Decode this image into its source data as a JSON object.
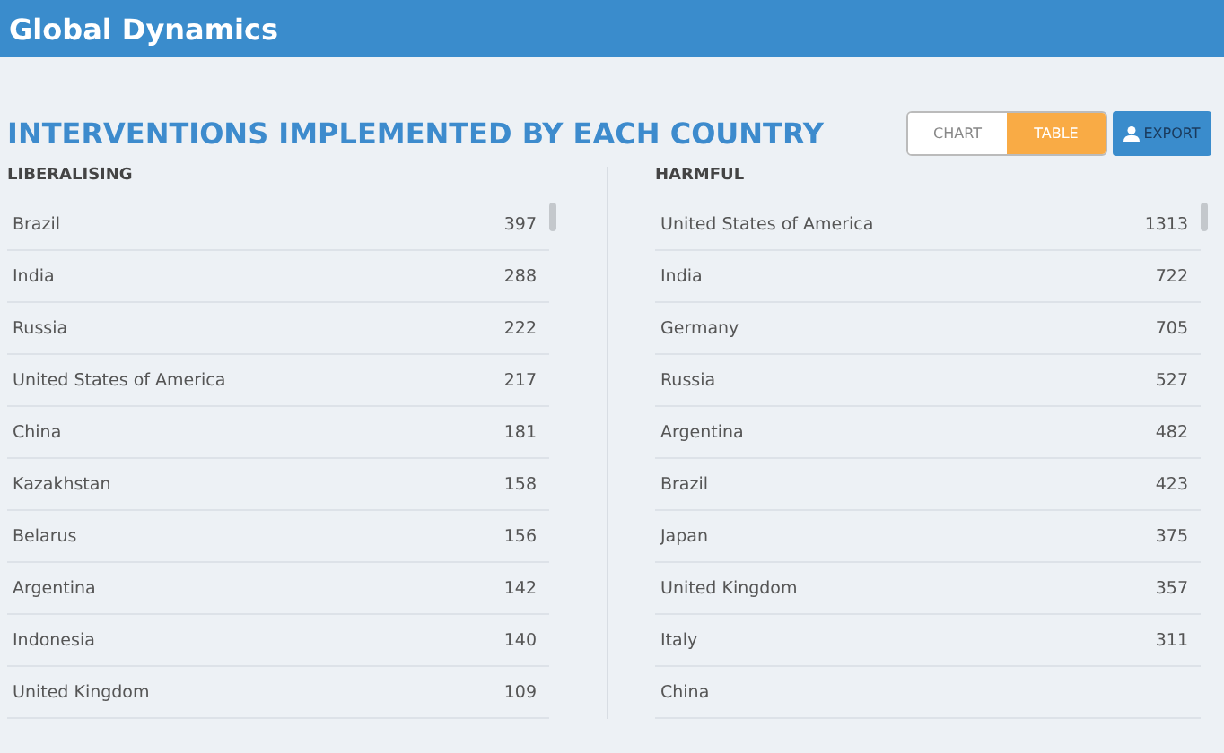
{
  "header": {
    "title": "Global Dynamics"
  },
  "section": {
    "title": "INTERVENTIONS IMPLEMENTED BY EACH COUNTRY"
  },
  "view_toggle": [
    {
      "label": "CHART",
      "selected": false
    },
    {
      "label": "TABLE",
      "selected": true
    }
  ],
  "export_button": {
    "label": "EXPORT"
  },
  "lists": [
    {
      "title": "LIBERALISING",
      "rows": [
        {
          "country": "Brazil",
          "count": "397"
        },
        {
          "country": "India",
          "count": "288"
        },
        {
          "country": "Russia",
          "count": "222"
        },
        {
          "country": "United States of America",
          "count": "217"
        },
        {
          "country": "China",
          "count": "181"
        },
        {
          "country": "Kazakhstan",
          "count": "158"
        },
        {
          "country": "Belarus",
          "count": "156"
        },
        {
          "country": "Argentina",
          "count": "142"
        },
        {
          "country": "Indonesia",
          "count": "140"
        },
        {
          "country": "United Kingdom",
          "count": "109"
        }
      ]
    },
    {
      "title": "HARMFUL",
      "rows": [
        {
          "country": "United States of America",
          "count": "1313"
        },
        {
          "country": "India",
          "count": "722"
        },
        {
          "country": "Germany",
          "count": "705"
        },
        {
          "country": "Russia",
          "count": "527"
        },
        {
          "country": "Argentina",
          "count": "482"
        },
        {
          "country": "Brazil",
          "count": "423"
        },
        {
          "country": "Japan",
          "count": "375"
        },
        {
          "country": "United Kingdom",
          "count": "357"
        },
        {
          "country": "Italy",
          "count": "311"
        },
        {
          "country": "China"
        }
      ]
    }
  ]
}
